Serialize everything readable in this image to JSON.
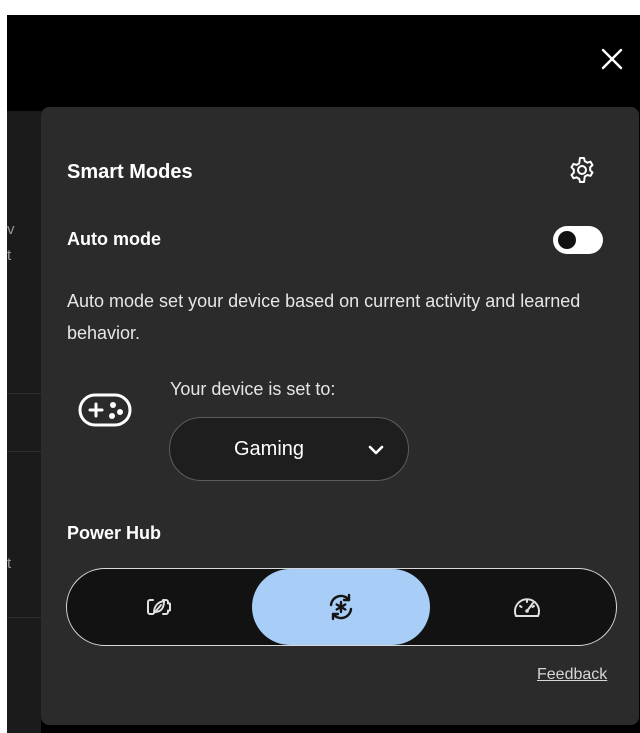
{
  "panel": {
    "title": "Smart Modes",
    "auto_mode": {
      "label": "Auto mode",
      "enabled": false,
      "description": "Auto mode set your device based on current activity and learned behavior."
    },
    "device_set_to_label": "Your device is set to:",
    "current_mode": "Gaming",
    "power_hub": {
      "label": "Power Hub",
      "options": [
        {
          "icon": "eco-leaf-battery-icon",
          "selected": false
        },
        {
          "icon": "balanced-sync-icon",
          "selected": true
        },
        {
          "icon": "performance-speedometer-icon",
          "selected": false
        }
      ]
    },
    "feedback_link": "Feedback"
  },
  "background_peek": [
    "v",
    "t",
    "t"
  ],
  "colors": {
    "window_bg": "#000000",
    "panel_bg": "#2b2b2b",
    "selected_segment": "#a8cdf7",
    "text": "#ffffff"
  }
}
